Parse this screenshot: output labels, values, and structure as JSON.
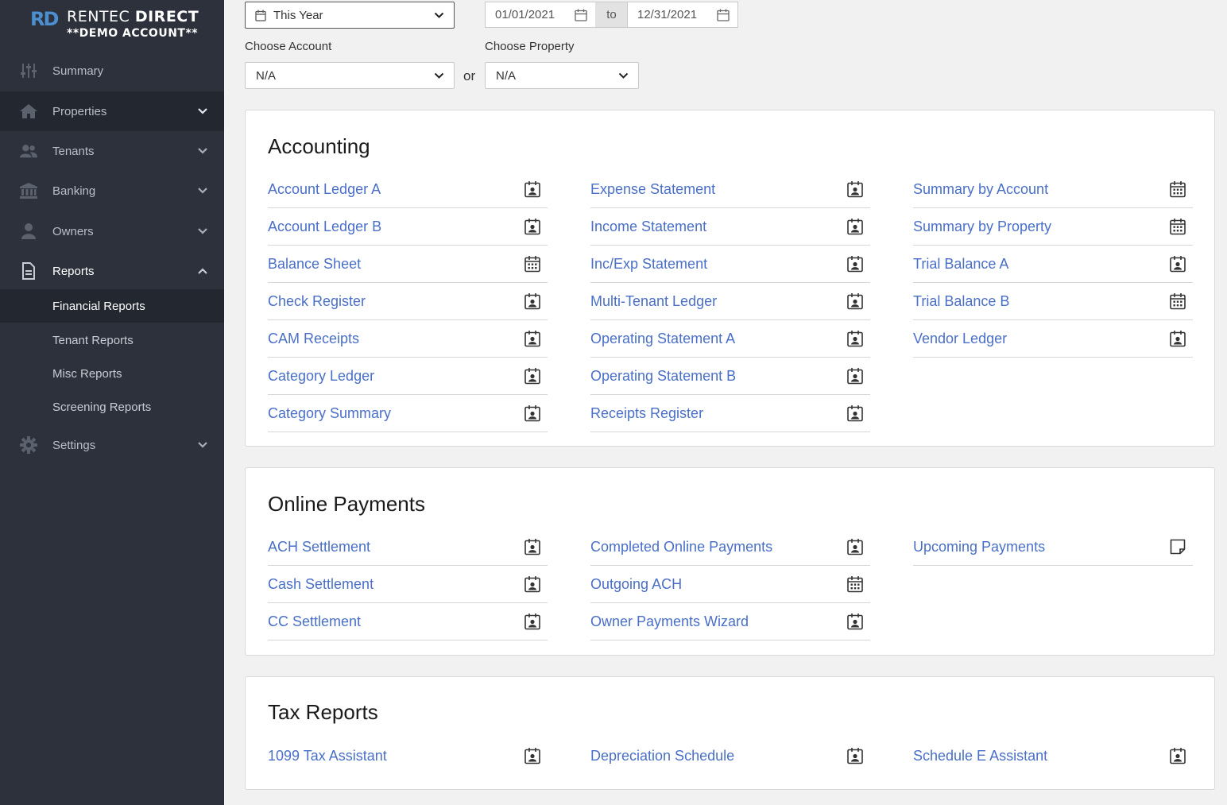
{
  "brand": {
    "logo_letters": "RD",
    "name_light": "RENTEC",
    "name_bold": "DIRECT",
    "subtitle": "**DEMO ACCOUNT**"
  },
  "sidebar": {
    "items": [
      {
        "label": "Summary"
      },
      {
        "label": "Properties"
      },
      {
        "label": "Tenants"
      },
      {
        "label": "Banking"
      },
      {
        "label": "Owners"
      },
      {
        "label": "Reports"
      },
      {
        "label": "Settings"
      }
    ],
    "report_subitems": [
      {
        "label": "Financial Reports"
      },
      {
        "label": "Tenant Reports"
      },
      {
        "label": "Misc Reports"
      },
      {
        "label": "Screening Reports"
      }
    ]
  },
  "filters": {
    "period": "This Year",
    "date_from": "01/01/2021",
    "date_to_label": "to",
    "date_to": "12/31/2021",
    "account_label": "Choose Account",
    "account_value": "N/A",
    "or_label": "or",
    "property_label": "Choose Property",
    "property_value": "N/A"
  },
  "sections": {
    "accounting": {
      "title": "Accounting",
      "col1": [
        "Account Ledger A",
        "Account Ledger B",
        "Balance Sheet",
        "Check Register",
        "CAM Receipts",
        "Category Ledger",
        "Category Summary"
      ],
      "col2": [
        "Expense Statement",
        "Income Statement",
        "Inc/Exp Statement",
        "Multi-Tenant Ledger",
        "Operating Statement A",
        "Operating Statement B",
        "Receipts Register"
      ],
      "col3": [
        "Summary by Account",
        "Summary by Property",
        "Trial Balance A",
        "Trial Balance B",
        "Vendor Ledger"
      ]
    },
    "online_payments": {
      "title": "Online Payments",
      "col1": [
        "ACH Settlement",
        "Cash Settlement",
        "CC Settlement"
      ],
      "col2": [
        "Completed Online Payments",
        "Outgoing ACH",
        "Owner Payments Wizard"
      ],
      "col3": [
        "Upcoming Payments"
      ]
    },
    "tax_reports": {
      "title": "Tax Reports",
      "col1": [
        "1099 Tax Assistant"
      ],
      "col2": [
        "Depreciation Schedule"
      ],
      "col3": [
        "Schedule E Assistant"
      ]
    }
  },
  "colors": {
    "sidebar_bg": "#2c313c",
    "sidebar_active": "#232730",
    "link": "#4a6fc7",
    "logo_blue": "#4b8fd0"
  }
}
